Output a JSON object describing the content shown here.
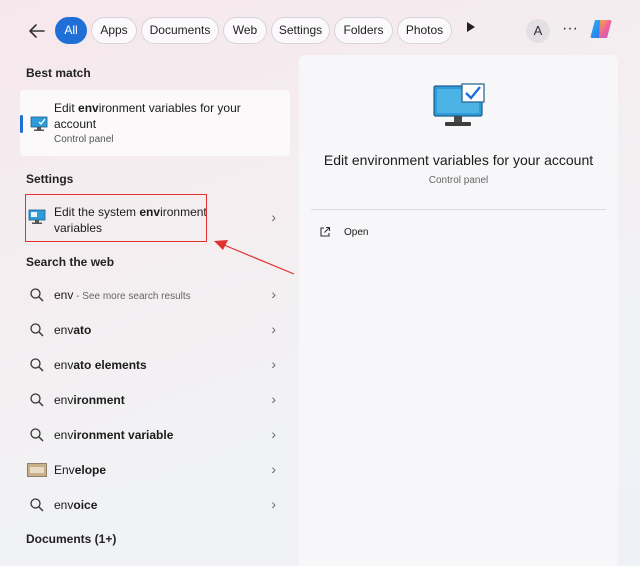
{
  "filters": {
    "back_icon": "back-arrow-icon",
    "tabs": [
      "All",
      "Apps",
      "Documents",
      "Web",
      "Settings",
      "Folders",
      "Photos"
    ],
    "play_icon": "play-icon",
    "account_initial": "A",
    "more_label": "···",
    "copilot_icon": "copilot-icon"
  },
  "sections": {
    "best_match": "Best match",
    "settings": "Settings",
    "search_web": "Search the web",
    "documents": "Documents (1+)"
  },
  "best_match": {
    "title_pre": "Edit ",
    "title_bold": "env",
    "title_post": "ironment variables for your account",
    "subtitle": "Control panel"
  },
  "settings_item": {
    "pre": "Edit the system ",
    "bold": "env",
    "post": "ironment variables"
  },
  "web_results": [
    {
      "bold": "env",
      "rest": "",
      "sub": " - See more search results"
    },
    {
      "bold": "env",
      "rest": "ato",
      "sub": ""
    },
    {
      "bold": "env",
      "rest": "ato elements",
      "sub": ""
    },
    {
      "bold": "env",
      "rest": "ironment",
      "sub": ""
    },
    {
      "bold": "env",
      "rest": "ironment variable",
      "sub": ""
    },
    {
      "bold": "Env",
      "rest": "elope",
      "sub": ""
    },
    {
      "bold": "env",
      "rest": "oice",
      "sub": ""
    }
  ],
  "detail": {
    "title": "Edit environment variables for your account",
    "subtitle": "Control panel",
    "open_label": "Open"
  },
  "colors": {
    "accent": "#1f6fd6",
    "highlight_box": "#e2312f"
  }
}
